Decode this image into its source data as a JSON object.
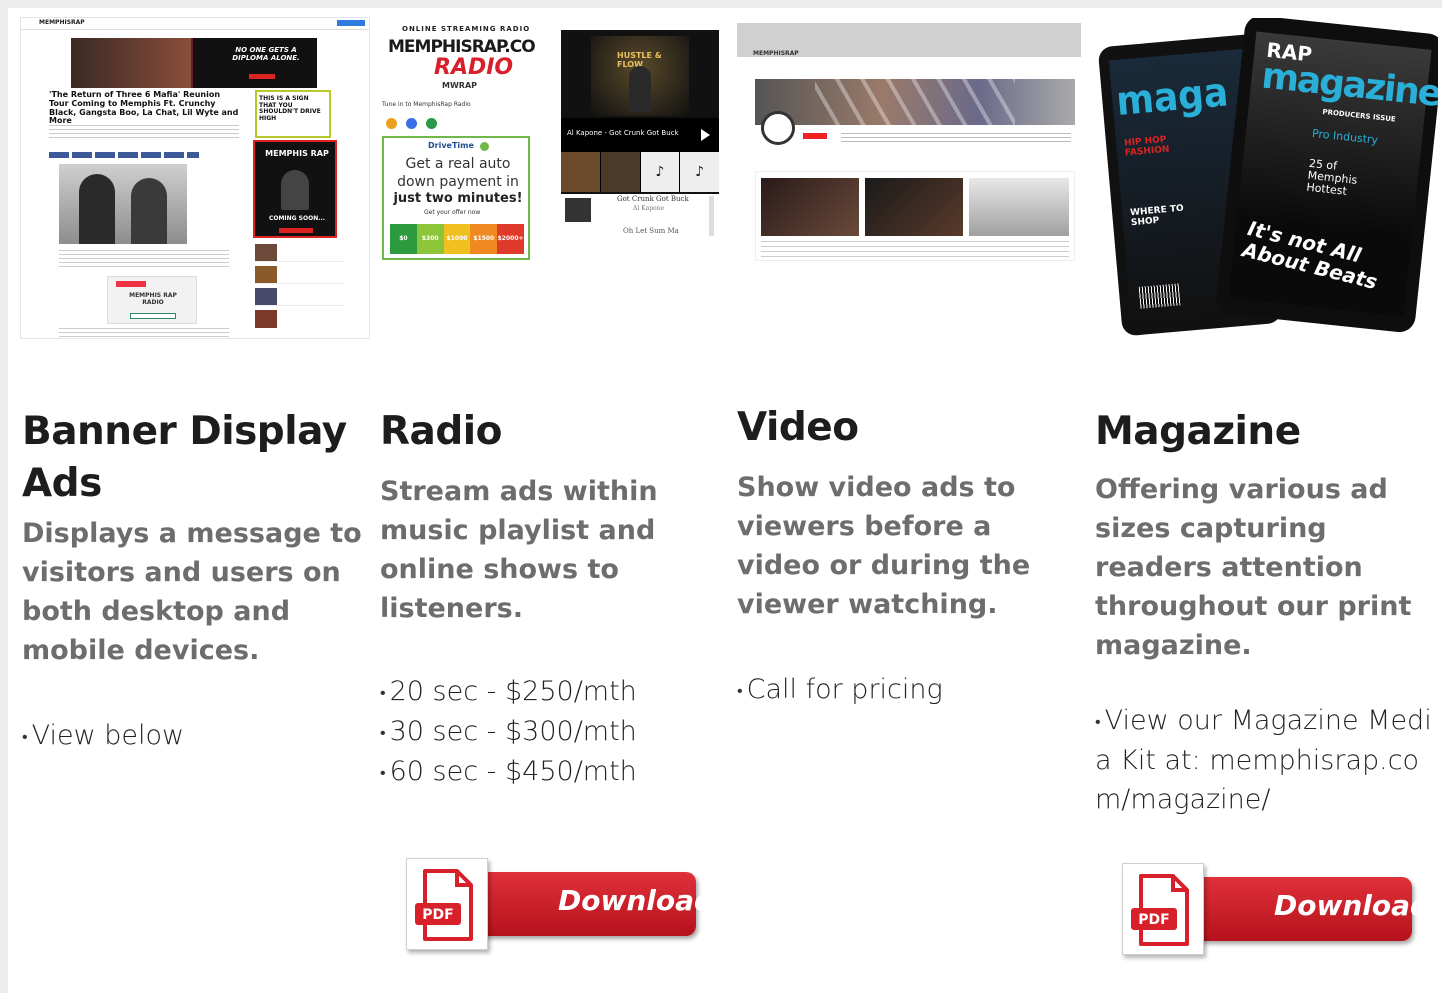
{
  "columns": [
    {
      "title": "Banner Display Ads",
      "description": "Displays a message to visitors and users on both desktop and mobile devices.",
      "bullets": [
        "View below"
      ]
    },
    {
      "title": "Radio",
      "description": "Stream ads within music playlist and online shows to listeners.",
      "bullets": [
        "20 sec - $250/mth",
        "30 sec - $300/mth",
        "60 sec - $450/mth"
      ],
      "download_label": "Download"
    },
    {
      "title": "Video",
      "description": "Show video ads to viewers before a video or during the viewer watching.",
      "bullets": [
        "Call for pricing"
      ]
    },
    {
      "title": "Magazine",
      "description": "Offering various ad sizes capturing readers attention throughout our print magazine.",
      "bullets": [
        "View our Magazine Media Kit at: memphisrap.com/magazine/"
      ],
      "download_label": "Download"
    }
  ],
  "pdf_badge": "PDF",
  "thumb_banner": {
    "site_name": "MEMPHISRAP",
    "hero_text": "NO ONE GETS A DIPLOMA ALONE.",
    "article_title": "'The Return of Three 6 Mafia' Reunion Tour Coming to Memphis Ft. Crunchy Black, Gangsta Boo, La Chat, Lil Wyte and More",
    "side_ad": "THIS IS A SIGN THAT YOU SHOULDN'T DRIVE HIGH",
    "side_mag": "MEMPHIS RAP",
    "coming_soon": "COMING SOON...",
    "radio_label": "MEMPHIS RAP RADIO"
  },
  "thumb_radio": {
    "tagline": "ONLINE STREAMING RADIO",
    "logo_main": "MEMPHISRAP.COM",
    "logo_sub": "RADIO",
    "call": "MWRAP",
    "tune_in": "Tune in to MemphisRap Radio",
    "ad_brand": "DriveTime",
    "ad_text_1": "Get a real auto down payment in",
    "ad_text_2": "just two minutes!",
    "ad_cta": "Get your offer now",
    "ad_prices": [
      "$0",
      "$300",
      "$1000",
      "$1500",
      "$2000+"
    ],
    "now_playing": "Al Kapone - Got Crunk Got Buck",
    "track_1": "Got Crunk Got Buck",
    "track_1_artist": "Al Kapone",
    "track_2": "Oh Let Sum Ma",
    "album": "HUSTLE & FLOW"
  },
  "thumb_video": {
    "channel": "MEMPHISRAP"
  },
  "thumb_magazine": {
    "title": "magazine",
    "brand": "RAP",
    "cover_line_1": "HIP HOP FASHION",
    "cover_line_2": "WHERE TO SHOP",
    "cover_line_3": "It's not All About Beats",
    "cover_line_4": "Pro Industry",
    "cover_line_5": "25 of Memphis Hottest",
    "issue": "PRODUCERS ISSUE"
  }
}
